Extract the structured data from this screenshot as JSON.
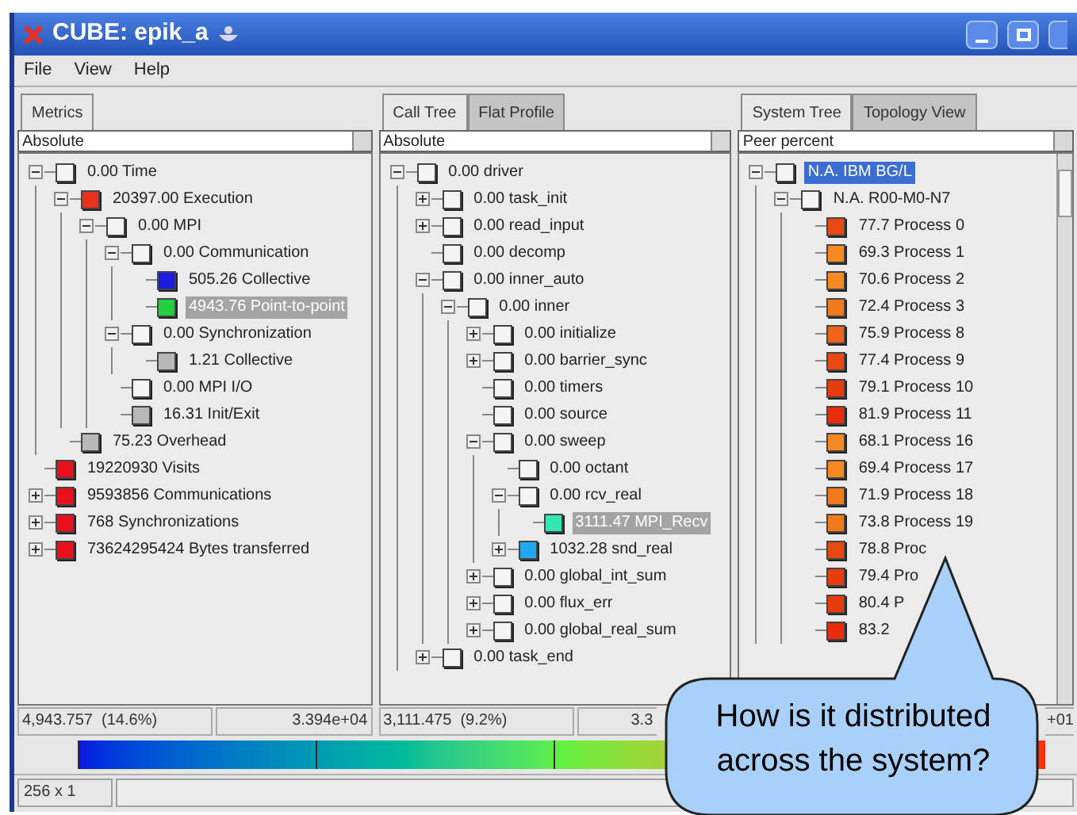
{
  "window": {
    "title": "CUBE: epik_a"
  },
  "menu": [
    "File",
    "View",
    "Help"
  ],
  "panels": [
    {
      "focused": false,
      "tabs": [
        {
          "label": "Metrics",
          "selected": true
        }
      ],
      "mode": "Absolute",
      "tree": [
        {
          "text": "0.00 Time",
          "color": "#f4f4f4",
          "expanded": true,
          "selected": false,
          "children": [
            {
              "text": "20397.00 Execution",
              "color": "#e8301c",
              "expanded": true,
              "selected": false,
              "children": [
                {
                  "text": "0.00 MPI",
                  "color": "#f4f4f4",
                  "expanded": true,
                  "selected": false,
                  "children": [
                    {
                      "text": "0.00 Communication",
                      "color": "#f4f4f4",
                      "expanded": true,
                      "selected": false,
                      "children": [
                        {
                          "text": "505.26 Collective",
                          "color": "#1c1ce0",
                          "selected": false
                        },
                        {
                          "text": "4943.76 Point-to-point",
                          "color": "#20d040",
                          "selected": true
                        }
                      ]
                    },
                    {
                      "text": "0.00 Synchronization",
                      "color": "#f4f4f4",
                      "expanded": true,
                      "selected": false,
                      "children": [
                        {
                          "text": "1.21 Collective",
                          "color": "#b8b8b8",
                          "selected": false
                        }
                      ]
                    },
                    {
                      "text": "0.00 MPI I/O",
                      "color": "#f4f4f4",
                      "selected": false
                    },
                    {
                      "text": "16.31 Init/Exit",
                      "color": "#b8b8b8",
                      "selected": false
                    }
                  ]
                }
              ]
            },
            {
              "text": "75.23 Overhead",
              "color": "#b8b8b8",
              "selected": false
            }
          ]
        },
        {
          "text": "19220930 Visits",
          "color": "#e8101c",
          "selected": false
        },
        {
          "text": "9593856 Communications",
          "color": "#e8101c",
          "expanded": false,
          "selected": false
        },
        {
          "text": "768 Synchronizations",
          "color": "#e8101c",
          "expanded": false,
          "selected": false
        },
        {
          "text": "73624295424 Bytes transferred",
          "color": "#e8101c",
          "expanded": false,
          "selected": false
        }
      ],
      "footer": [
        "4,943.757  (14.6%)",
        "3.394e+04"
      ]
    },
    {
      "focused": false,
      "tabs": [
        {
          "label": "Call Tree",
          "selected": true
        },
        {
          "label": "Flat Profile",
          "selected": false
        }
      ],
      "mode": "Absolute",
      "tree": [
        {
          "text": "0.00 driver",
          "color": "#f4f4f4",
          "expanded": true,
          "selected": false,
          "children": [
            {
              "text": "0.00 task_init",
              "color": "#f4f4f4",
              "expanded": false,
              "selected": false
            },
            {
              "text": "0.00 read_input",
              "color": "#f4f4f4",
              "expanded": false,
              "selected": false
            },
            {
              "text": "0.00 decomp",
              "color": "#f4f4f4",
              "selected": false
            },
            {
              "text": "0.00 inner_auto",
              "color": "#f4f4f4",
              "expanded": true,
              "selected": false,
              "children": [
                {
                  "text": "0.00 inner",
                  "color": "#f4f4f4",
                  "expanded": true,
                  "selected": false,
                  "children": [
                    {
                      "text": "0.00 initialize",
                      "color": "#f4f4f4",
                      "expanded": false,
                      "selected": false
                    },
                    {
                      "text": "0.00 barrier_sync",
                      "color": "#f4f4f4",
                      "expanded": false,
                      "selected": false
                    },
                    {
                      "text": "0.00 timers",
                      "color": "#f4f4f4",
                      "selected": false
                    },
                    {
                      "text": "0.00 source",
                      "color": "#f4f4f4",
                      "selected": false
                    },
                    {
                      "text": "0.00 sweep",
                      "color": "#f4f4f4",
                      "expanded": true,
                      "selected": false,
                      "children": [
                        {
                          "text": "0.00 octant",
                          "color": "#f4f4f4",
                          "selected": false
                        },
                        {
                          "text": "0.00 rcv_real",
                          "color": "#f4f4f4",
                          "expanded": true,
                          "selected": false,
                          "children": [
                            {
                              "text": "3111.47 MPI_Recv",
                              "color": "#30e8b0",
                              "selected": true
                            }
                          ]
                        },
                        {
                          "text": "1032.28 snd_real",
                          "color": "#20a8f0",
                          "expanded": false,
                          "selected": false
                        }
                      ]
                    },
                    {
                      "text": "0.00 global_int_sum",
                      "color": "#f4f4f4",
                      "expanded": false,
                      "selected": false
                    },
                    {
                      "text": "0.00 flux_err",
                      "color": "#f4f4f4",
                      "expanded": false,
                      "selected": false
                    },
                    {
                      "text": "0.00 global_real_sum",
                      "color": "#f4f4f4",
                      "expanded": false,
                      "selected": false
                    }
                  ]
                }
              ]
            },
            {
              "text": "0.00 task_end",
              "color": "#f4f4f4",
              "expanded": false,
              "selected": false
            }
          ]
        }
      ],
      "footer": [
        "3,111.475  (9.2%)",
        "3.3"
      ]
    },
    {
      "focused": true,
      "tabs": [
        {
          "label": "System Tree",
          "selected": true
        },
        {
          "label": "Topology View",
          "selected": false
        }
      ],
      "mode": "Peer percent",
      "tree": [
        {
          "text": "N.A. IBM BG/L",
          "color": "#f4f4f4",
          "expanded": true,
          "selected": true,
          "children": [
            {
              "text": "N.A. R00-M0-N7",
              "color": "#f4f4f4",
              "expanded": true,
              "selected": false,
              "children": [
                {
                  "text": "77.7 Process 0",
                  "color": "#e84812",
                  "selected": false
                },
                {
                  "text": "69.3 Process 1",
                  "color": "#f58a22",
                  "selected": false
                },
                {
                  "text": "70.6 Process 2",
                  "color": "#f58a22",
                  "selected": false
                },
                {
                  "text": "72.4 Process 3",
                  "color": "#f07a1c",
                  "selected": false
                },
                {
                  "text": "75.9 Process 8",
                  "color": "#ee6418",
                  "selected": false
                },
                {
                  "text": "77.4 Process 9",
                  "color": "#e84812",
                  "selected": false
                },
                {
                  "text": "79.1 Process 10",
                  "color": "#e83c10",
                  "selected": false
                },
                {
                  "text": "81.9 Process 11",
                  "color": "#e82c0c",
                  "selected": false
                },
                {
                  "text": "68.1 Process 16",
                  "color": "#f58a22",
                  "selected": false
                },
                {
                  "text": "69.4 Process 17",
                  "color": "#f58a22",
                  "selected": false
                },
                {
                  "text": "71.9 Process 18",
                  "color": "#f07a1c",
                  "selected": false
                },
                {
                  "text": "73.8 Process 19",
                  "color": "#f07a1c",
                  "selected": false
                },
                {
                  "text": "78.8 Proc",
                  "color": "#e84812",
                  "selected": false
                },
                {
                  "text": "79.4 Pro",
                  "color": "#e83c10",
                  "selected": false
                },
                {
                  "text": "80.4 P",
                  "color": "#e83c10",
                  "selected": false
                },
                {
                  "text": "83.2",
                  "color": "#e82c0c",
                  "selected": false
                }
              ]
            }
          ]
        }
      ],
      "footer": [
        "+01"
      ]
    }
  ],
  "status": "256 x 1",
  "callout": "How is it distributed across the system?"
}
